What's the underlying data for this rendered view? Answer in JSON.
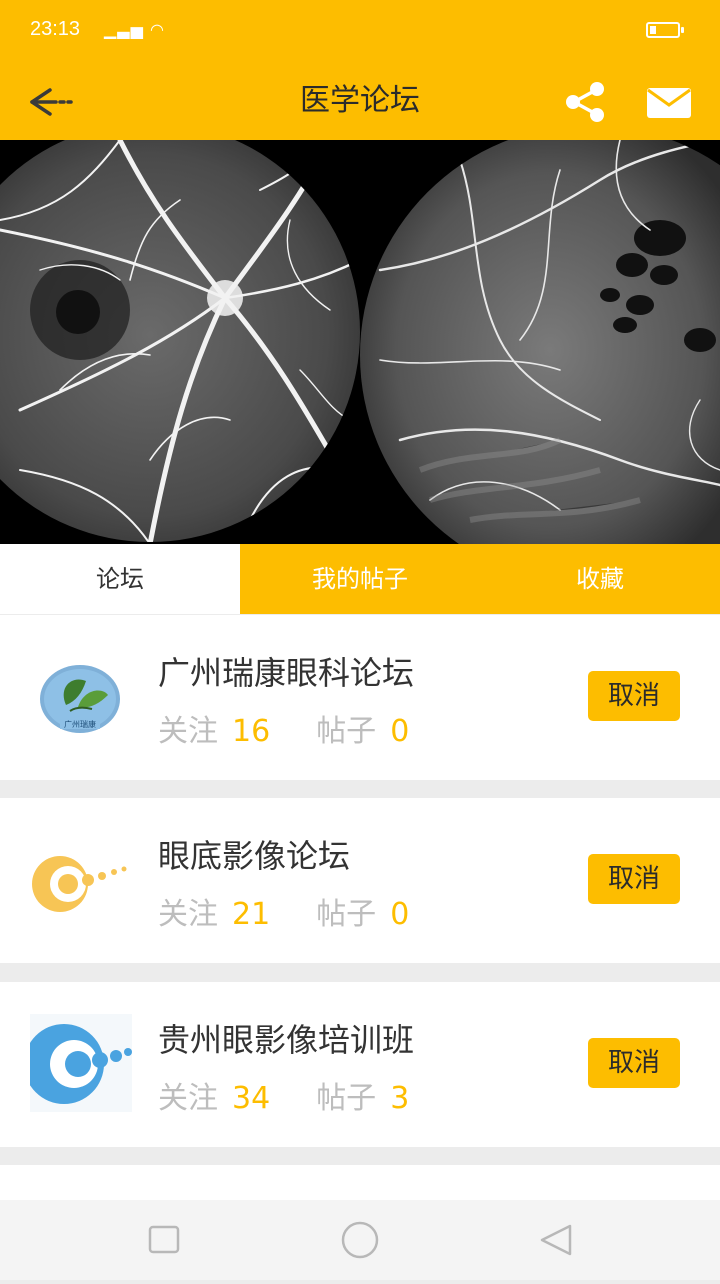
{
  "status": {
    "time": "23:13",
    "signal": "▁▃▅ ◠"
  },
  "header": {
    "title": "医学论坛",
    "back_icon": "arrow-left-icon",
    "share_icon": "share-icon",
    "mail_icon": "mail-icon"
  },
  "banner": {
    "slides_total": 3,
    "active_index": 0
  },
  "tabs": [
    {
      "label": "论坛",
      "active": true
    },
    {
      "label": "我的帖子",
      "active": false
    },
    {
      "label": "收藏",
      "active": false
    }
  ],
  "forums": [
    {
      "name": "广州瑞康眼科论坛",
      "follow_label": "关注",
      "follow_count": "16",
      "post_label": "帖子",
      "post_count": "0",
      "action_label": "取消",
      "logo_icon": "leaf-logo-icon",
      "logo_text": "广州瑞康"
    },
    {
      "name": "眼底影像论坛",
      "follow_label": "关注",
      "follow_count": "21",
      "post_label": "帖子",
      "post_count": "0",
      "action_label": "取消",
      "logo_icon": "eye-logo-yellow-icon"
    },
    {
      "name": "贵州眼影像培训班",
      "follow_label": "关注",
      "follow_count": "34",
      "post_label": "帖子",
      "post_count": "3",
      "action_label": "取消",
      "logo_icon": "eye-logo-blue-icon"
    }
  ],
  "colors": {
    "accent": "#fdbd00",
    "muted": "#bdbdbd",
    "text": "#333333"
  }
}
